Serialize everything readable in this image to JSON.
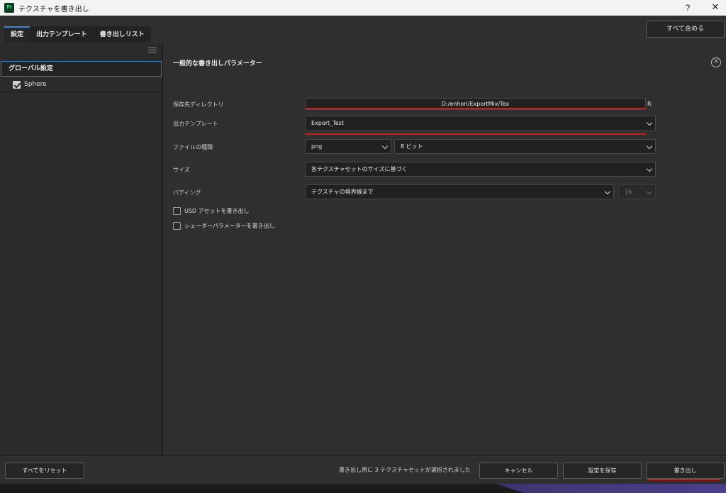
{
  "window": {
    "app_badge": "Pt",
    "title": "テクスチャを書き出し",
    "help_label": "?",
    "close_label": "✕"
  },
  "tabs": [
    {
      "label": "設定"
    },
    {
      "label": "出力テンプレート"
    },
    {
      "label": "書き出しリスト"
    }
  ],
  "header": {
    "include_all_label": "すべて含める"
  },
  "left_panel": {
    "global_label": "グローバル設定",
    "items": [
      {
        "label": "Sphere",
        "checked": true
      }
    ]
  },
  "main": {
    "section_title": "一般的な書き出しパラメーター",
    "rows": {
      "output_dir": {
        "label": "保存先ディレクトリ",
        "value": "D:/enhori/ExportMix/Tex",
        "suffix": "R"
      },
      "template": {
        "label": "出力テンプレート",
        "value": "Export_Test"
      },
      "file_type": {
        "label": "ファイルの種類",
        "format": "png",
        "bit_depth": "8 ビット"
      },
      "size": {
        "label": "サイズ",
        "value": "各テクスチャセットのサイズに基づく"
      },
      "padding": {
        "label": "パディング",
        "value": "テクスチャの境界線まで",
        "amount": "16"
      }
    },
    "options": [
      {
        "label": "USD アセットを書き出し",
        "checked": false
      },
      {
        "label": "シェーダーパラメーターを書き出し",
        "checked": false
      }
    ]
  },
  "footer": {
    "reset_all_label": "すべてをリセット",
    "status": "書き出し用に 3 テクスチャセットが選択されました",
    "cancel_label": "キャンセル",
    "save_settings_label": "設定を保存",
    "export_label": "書き出し"
  },
  "colors": {
    "accent_blue": "#3a86d8",
    "annotation_red": "#c81e1e",
    "panel_bg": "#2f2f2f"
  }
}
